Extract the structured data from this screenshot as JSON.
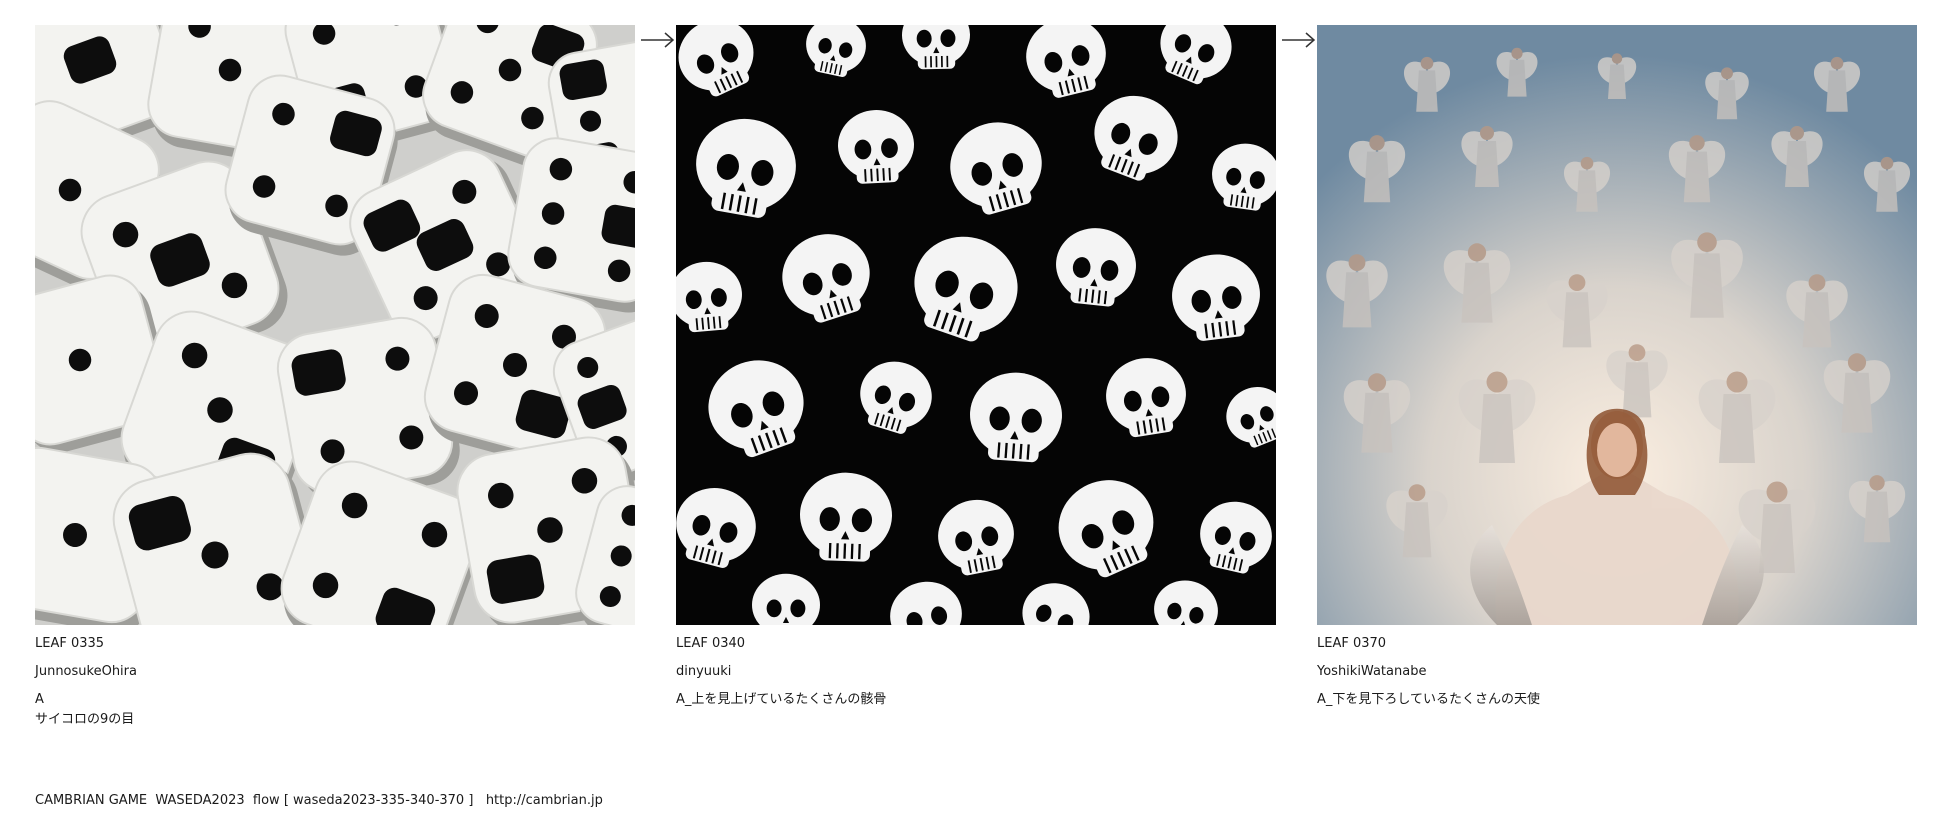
{
  "leaves": [
    {
      "id": "LEAF 0335",
      "author": "JunnosukeOhira",
      "prompt": "A\nサイコロの9の目",
      "image_subject": "white-dice-with-black-pips"
    },
    {
      "id": "LEAF 0340",
      "author": "dinyuuki",
      "prompt": "A_上を見上げているたくさんの骸骨",
      "image_subject": "many-white-skulls-on-black"
    },
    {
      "id": "LEAF 0370",
      "author": "YoshikiWatanabe",
      "prompt": "A_下を見下ろしているたくさんの天使",
      "image_subject": "many-angels-in-cloudy-sky"
    }
  ],
  "arrows": [
    "arrow-right-icon",
    "arrow-right-icon"
  ],
  "footer": {
    "text": "CAMBRIAN GAME  WASEDA2023  flow [ waseda2023-335-340-370 ]   ",
    "link": "http://cambrian.jp"
  },
  "colors": {
    "text": "#1a1a1a",
    "background": "#ffffff",
    "sky_top": "#6f8aa1",
    "sky_glow": "#f1e2d0"
  }
}
